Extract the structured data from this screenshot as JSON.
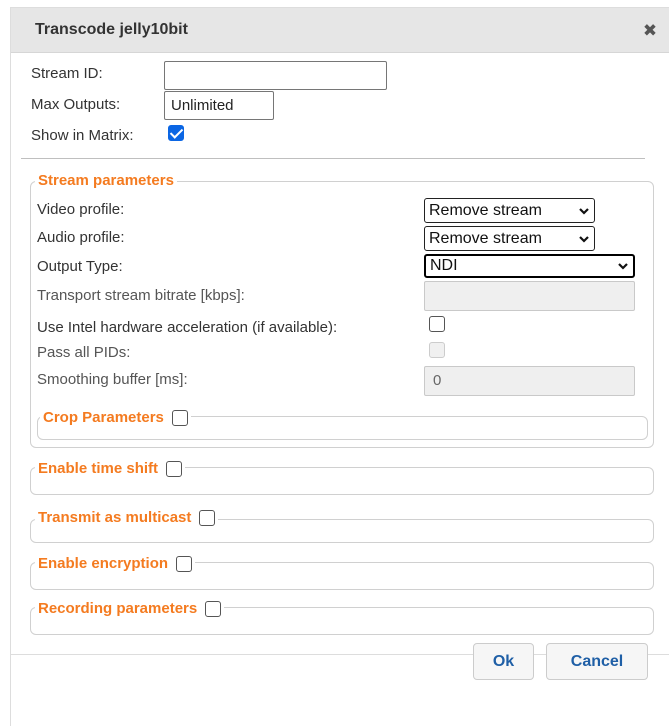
{
  "dialog": {
    "title": "Transcode jelly10bit",
    "close_icon": "close-icon",
    "close_glyph": "✖"
  },
  "general": {
    "stream_id_label": "Stream ID:",
    "stream_id_value": "",
    "max_outputs_label": "Max Outputs:",
    "max_outputs_value": "Unlimited",
    "show_in_matrix_label": "Show in Matrix:",
    "show_in_matrix_checked": true
  },
  "stream_parameters": {
    "legend": "Stream parameters",
    "video_profile_label": "Video profile:",
    "video_profile_value": "Remove stream",
    "audio_profile_label": "Audio profile:",
    "audio_profile_value": "Remove stream",
    "output_type_label": "Output Type:",
    "output_type_value": "NDI",
    "transport_bitrate_label": "Transport stream bitrate [kbps]:",
    "transport_bitrate_value": "",
    "intel_hw_label": "Use Intel hardware acceleration (if available):",
    "pass_pids_label": "Pass all PIDs:",
    "smoothing_label": "Smoothing buffer [ms]:",
    "smoothing_value": "0",
    "crop_legend": "Crop Parameters"
  },
  "sections": {
    "time_shift": "Enable time shift",
    "multicast": "Transmit as multicast",
    "encryption": "Enable encryption",
    "recording": "Recording parameters"
  },
  "buttons": {
    "ok": "Ok",
    "cancel": "Cancel"
  },
  "colors": {
    "accent_orange": "#f47b20",
    "checkbox_blue": "#0b66e4",
    "button_text": "#1f5fa6"
  }
}
